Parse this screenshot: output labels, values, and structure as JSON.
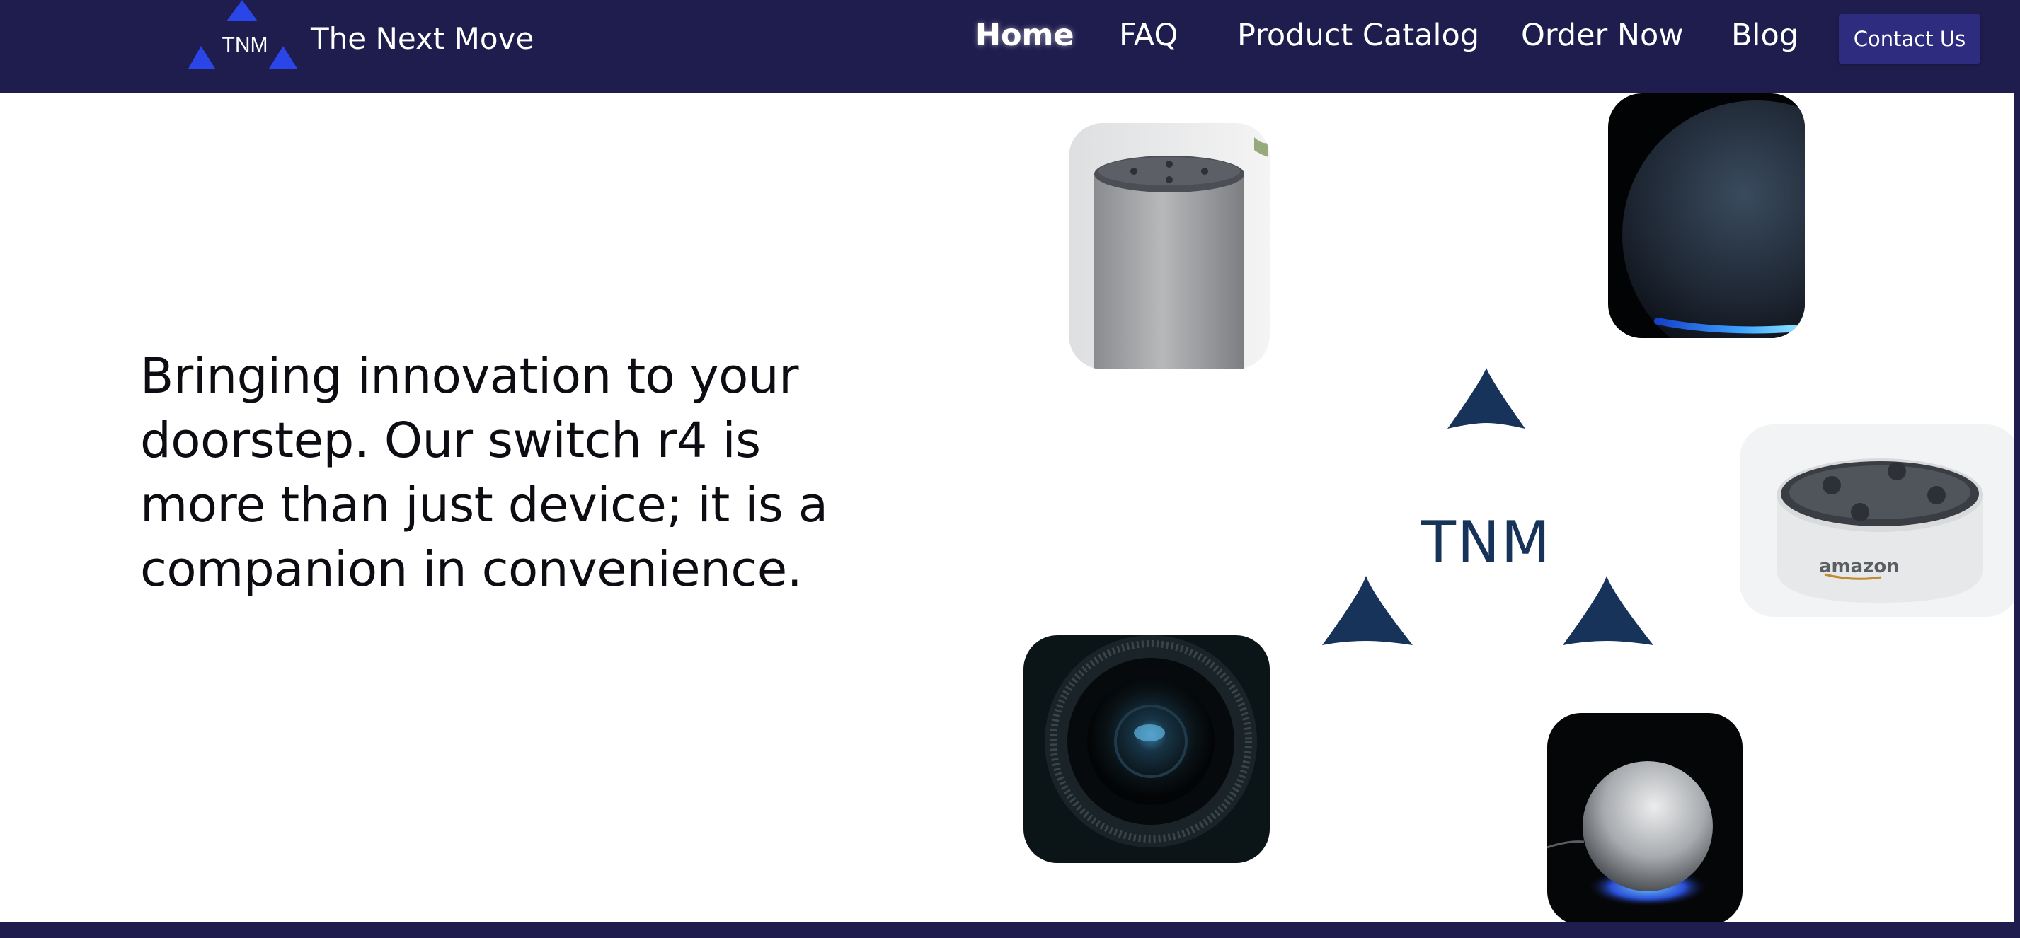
{
  "header": {
    "logo_text": "TNM",
    "brand_name": "The Next Move",
    "nav": [
      {
        "label": "Home",
        "active": true
      },
      {
        "label": "FAQ",
        "active": false
      },
      {
        "label": "Product Catalog",
        "active": false
      },
      {
        "label": "Order Now",
        "active": false
      },
      {
        "label": "Blog",
        "active": false
      }
    ],
    "contact_label": "Contact Us"
  },
  "hero": {
    "text": "Bringing innovation to your doorstep. Our switch r4 is more than just device; it is a companion in convenience."
  },
  "center_logo": {
    "text": "TNM"
  },
  "products": [
    {
      "name": "cylinder-speaker-image"
    },
    {
      "name": "dark-sphere-speaker-image"
    },
    {
      "name": "echo-dot-image",
      "brand_text": "amazon"
    },
    {
      "name": "camera-lens-image"
    },
    {
      "name": "white-sphere-speaker-image"
    }
  ],
  "colors": {
    "header_bg": "#1f1d4d",
    "contact_bg": "#2e2c7f",
    "logo_triangle": "#2b46e8",
    "center_logo": "#17335a"
  }
}
